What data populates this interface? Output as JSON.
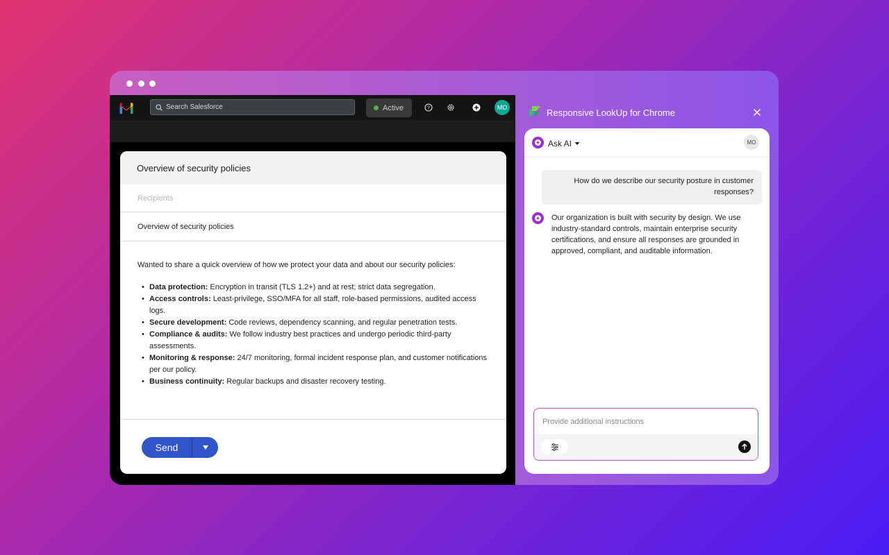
{
  "browser": {
    "window_dots": 3
  },
  "salesforce_bar": {
    "search_placeholder": "Search Salesforce",
    "status_label": "Active",
    "user_initials": "MO",
    "status_color": "#4caf50",
    "avatar_color": "#10a592"
  },
  "compose": {
    "header_title": "Overview of security policies",
    "recipients_placeholder": "Recipients",
    "subject": "Overview of security policies",
    "intro": "Wanted to share a quick overview of how we protect your data and about our security policies:",
    "bullets": [
      {
        "label": "Data protection:",
        "text": " Encryption in transit (TLS 1.2+) and at rest; strict data segregation."
      },
      {
        "label": "Access controls:",
        "text": " Least-privilege, SSO/MFA for all staff, role-based permissions, audited access logs."
      },
      {
        "label": "Secure development:",
        "text": " Code reviews, dependency scanning, and regular penetration tests."
      },
      {
        "label": "Compliance & audits:",
        "text": " We follow industry best practices and undergo periodic third-party assessments."
      },
      {
        "label": "Monitoring & response:",
        "text": " 24/7 monitoring, formal incident response plan, and customer notifications per our policy."
      },
      {
        "label": "Business continuity:",
        "text": " Regular backups and disaster recovery testing."
      }
    ],
    "send_label": "Send",
    "send_color": "#3154c8"
  },
  "extension": {
    "title": "Responsive LookUp for Chrome",
    "assistant_label": "Ask AI",
    "user_initials": "MO",
    "user_message": "How do we describe our security posture in customer responses?",
    "ai_message": "Our organization is built with security by design. We use industry-standard controls, maintain enterprise security certifications, and ensure all responses are grounded in approved, compliant, and auditable information.",
    "input_placeholder": "Provide additional instructions",
    "accent_color": "#9b2fc9"
  }
}
